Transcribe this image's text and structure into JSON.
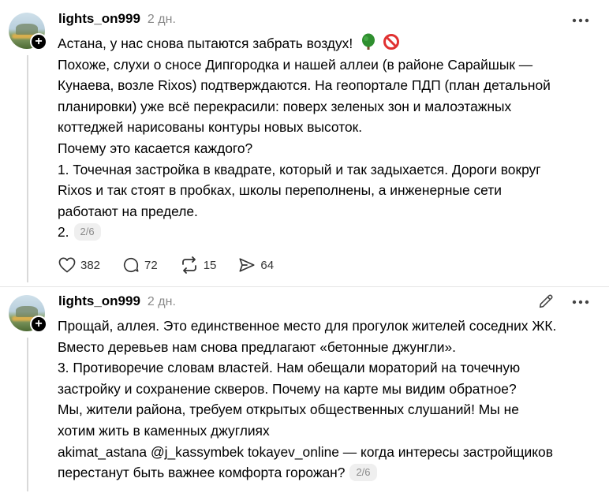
{
  "posts": [
    {
      "username": "lights_on999",
      "time": "2 дн.",
      "lines": [
        "Астана, у нас снова пытаются забрать воздух!",
        "Похоже, слухи о сносе Дипгородка и нашей аллеи (в районе Сарайшык —",
        "Кунаева, возле Rixos) подтверждаются. На геопортале ПДП (план детальной",
        "планировки) уже всё перекрасили: поверх зеленых зон и малоэтажных",
        "коттеджей нарисованы контуры новых высоток.",
        "Почему это касается каждого?",
        "1. Точечная застройка в квадрате, который и так задыхается. Дороги вокруг",
        "Rixos и так стоят в пробках, школы переполнены, а инженерные сети",
        "работают на пределе.",
        "2."
      ],
      "page_badge": "2/6",
      "actions": {
        "likes": "382",
        "comments": "72",
        "reposts": "15",
        "shares": "64"
      },
      "icons": [
        "like-icon",
        "comment-icon",
        "repost-icon",
        "share-icon",
        "more-icon"
      ]
    },
    {
      "username": "lights_on999",
      "time": "2 дн.",
      "lines": [
        "Прощай, аллея. Это единственное место для прогулок жителей соседних ЖК.",
        "Вместо деревьев нам снова предлагают «бетонные джунгли».",
        "3. Противоречие словам властей. Нам обещали мораторий на точечную",
        "застройку и сохранение скверов. Почему на карте мы видим обратное?",
        "Мы, жители района, требуем открытых общественных слушаний! Мы не",
        "хотим жить в каменных джуглиях",
        "akimat_astana @j_kassymbek tokayev_online — когда интересы застройщиков",
        "перестанут быть важнее комфорта горожан?"
      ],
      "page_badge": "2/6",
      "icons": [
        "edit-icon",
        "more-icon"
      ]
    }
  ],
  "colors": {
    "text": "#000000",
    "muted": "#8a8a8a",
    "thread_line": "#d9d9d9",
    "badge_bg": "#efefef"
  }
}
